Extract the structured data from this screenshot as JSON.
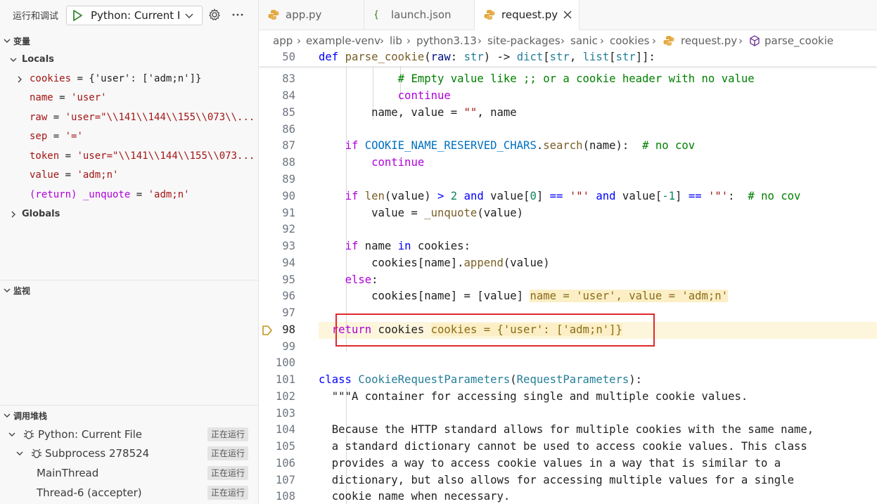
{
  "debug": {
    "title": "运行和调试",
    "launch_config": "Python: Current Fi",
    "sections": {
      "variables": "变量",
      "watch": "监视",
      "callstack": "调用堆栈"
    },
    "locals_label": "Locals",
    "globals_label": "Globals",
    "variables": [
      {
        "name": "cookies",
        "eq": " = ",
        "value": "{'user': ['adm;n']}",
        "expandable": true
      },
      {
        "name": "name",
        "eq": " = ",
        "value": "'user'"
      },
      {
        "name": "raw",
        "eq": " = ",
        "value": "'user=\"\\\\141\\\\144\\\\155\\\\073\\\\..."
      },
      {
        "name": "sep",
        "eq": " = ",
        "value": "'='"
      },
      {
        "name": "token",
        "eq": " = ",
        "value": "'user=\"\\\\141\\\\144\\\\155\\\\073..."
      },
      {
        "name": "value",
        "eq": " = ",
        "value": "'adm;n'"
      },
      {
        "name": "(return) _unquote",
        "eq": " = ",
        "value": "'adm;n'"
      }
    ],
    "callstack": [
      {
        "label": "Python: Current File",
        "status": "正在运行"
      },
      {
        "label": "Subprocess 278524",
        "status": "正在运行"
      },
      {
        "label": "MainThread",
        "status": "正在运行"
      },
      {
        "label": "Thread-6 (accepter)",
        "status": "正在运行"
      }
    ]
  },
  "editor": {
    "tabs": [
      {
        "label": "app.py",
        "active": false
      },
      {
        "label": "launch.json",
        "active": false
      },
      {
        "label": "request.py",
        "active": true
      }
    ],
    "breadcrumbs": [
      "app",
      "example-venv",
      "lib",
      "python3.13",
      "site-packages",
      "sanic",
      "cookies",
      "request.py",
      "parse_cookie"
    ],
    "sticky_line": {
      "num": "50"
    },
    "line_numbers": [
      "83",
      "84",
      "85",
      "86",
      "87",
      "88",
      "89",
      "90",
      "91",
      "92",
      "93",
      "94",
      "95",
      "96",
      "97",
      "98",
      "99",
      "100",
      "101",
      "102",
      "103",
      "104",
      "105",
      "106",
      "107",
      "108"
    ],
    "inline_values": {
      "line96": "name = 'user', value = 'adm;n'",
      "line98": "cookies = {'user': ['adm;n']}"
    },
    "comments": {
      "line83": "# Empty value like ;; or a cookie header with no value",
      "nocov": "# no cov"
    },
    "docstring": [
      "\"\"\"A container for accessing single and multiple cookie values.",
      "",
      "Because the HTTP standard allows for multiple cookies with the same name,",
      "a standard dictionary cannot be used to access cookie values. This class",
      "provides a way to access cookie values in a way that is similar to a",
      "dictionary, but also allows for accessing multiple values for a single",
      "cookie name when necessary."
    ]
  },
  "colors": {
    "highlight_box": "#e0292c",
    "current_line": "#fdf6dc",
    "inline_value_bg": "#fcefc6"
  }
}
